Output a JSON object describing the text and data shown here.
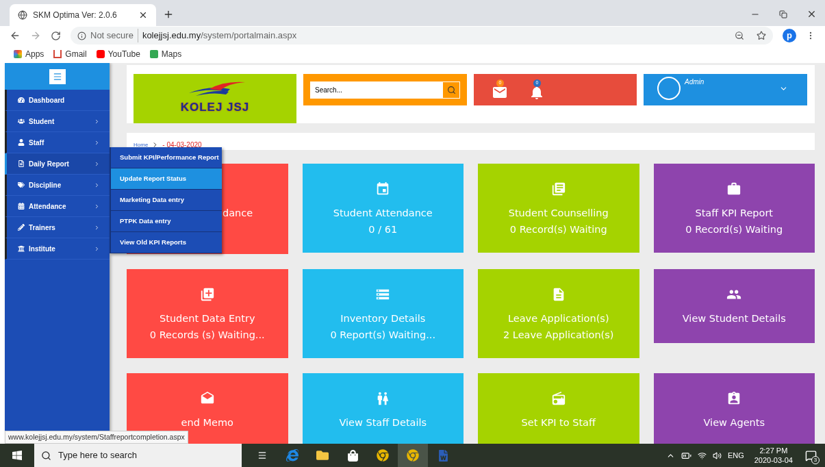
{
  "browser": {
    "tab_title": "SKM Optima Ver: 2.0.6",
    "security_label": "Not secure",
    "url_domain": "kolejjsj.edu.my",
    "url_path": "/system/portalmain.aspx",
    "profile_initial": "p",
    "bookmarks": [
      {
        "label": "Apps"
      },
      {
        "label": "Gmail"
      },
      {
        "label": "YouTube"
      },
      {
        "label": "Maps"
      }
    ]
  },
  "sidebar": {
    "items": [
      {
        "label": "Dashboard",
        "kind": "link",
        "expanded": false
      },
      {
        "label": "Student",
        "kind": "menu",
        "expanded": false
      },
      {
        "label": "Staff",
        "kind": "menu",
        "expanded": false
      },
      {
        "label": "Daily Report",
        "kind": "menu",
        "expanded": true
      },
      {
        "label": "Discipline",
        "kind": "menu",
        "expanded": false
      },
      {
        "label": "Attendance",
        "kind": "menu",
        "expanded": false
      },
      {
        "label": "Trainers",
        "kind": "menu",
        "expanded": false
      },
      {
        "label": "Institute",
        "kind": "menu",
        "expanded": false
      }
    ]
  },
  "submenu": {
    "items": [
      {
        "label": "Submit KPI/Performance Report",
        "selected": false
      },
      {
        "label": "Update Report Status",
        "selected": true
      },
      {
        "label": "Marketing Data entry",
        "selected": false
      },
      {
        "label": "PTPK Data entry",
        "selected": false
      },
      {
        "label": "View Old KPI Reports",
        "selected": false
      }
    ]
  },
  "header": {
    "logo_text": "KOLEJ JSJ",
    "search_placeholder": "Search...",
    "mail_badge": "0",
    "bell_badge": "0",
    "user_name": "Admin"
  },
  "breadcrumb": {
    "home": "Home",
    "current": "- 04-03-2020"
  },
  "tiles": [
    {
      "kind": "partly_hidden",
      "title": "dance",
      "color": "#ff4a44"
    },
    {
      "kind": "full",
      "title": "Student Attendance",
      "subtitle": "0  / 61",
      "color": "#22bdee"
    },
    {
      "kind": "full",
      "title": "Student Counselling",
      "subtitle": "0 Record(s) Waiting",
      "color": "#a5d300"
    },
    {
      "kind": "full",
      "title": "Staff KPI Report",
      "subtitle": "0 Record(s) Waiting",
      "color": "#8e44ad"
    },
    {
      "kind": "full",
      "title": "Student Data Entry",
      "subtitle": "0 Records (s) Waiting...",
      "color": "#ff4a44"
    },
    {
      "kind": "full",
      "title": "Inventory Details",
      "subtitle": "0 Report(s) Waiting...",
      "color": "#22bdee"
    },
    {
      "kind": "full",
      "title": "Leave Application(s)",
      "subtitle": "2 Leave Application(s)",
      "color": "#a5d300"
    },
    {
      "kind": "full",
      "title": "View Student Details",
      "color": "#8e44ad"
    },
    {
      "kind": "full",
      "title": "end Memo",
      "color": "#ff4a44"
    },
    {
      "kind": "full",
      "title": "View Staff Details",
      "color": "#22bdee"
    },
    {
      "kind": "full",
      "title": "Set KPI to Staff",
      "color": "#a5d300"
    },
    {
      "kind": "full",
      "title": "View Agents",
      "color": "#8e44ad"
    }
  ],
  "status_url": "www.kolejjsj.edu.my/system/Staffreportcompletion.aspx",
  "taskbar": {
    "search_placeholder": "Type here to search",
    "language": "ENG",
    "time": "2:27 PM",
    "date": "2020-03-04",
    "notifications": "3"
  }
}
